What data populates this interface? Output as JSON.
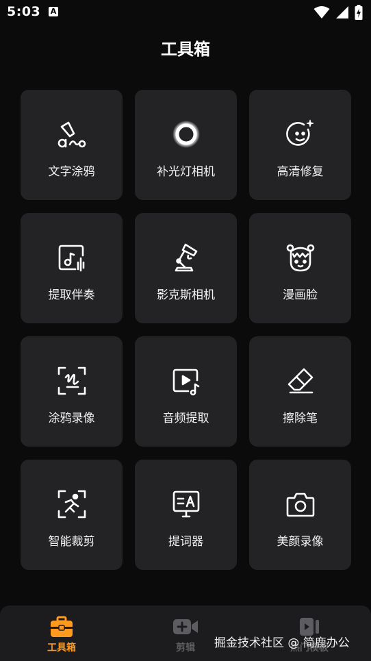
{
  "status_bar": {
    "time": "5:03",
    "notification_letter": "A",
    "icons": [
      "wifi-icon",
      "signal-icon",
      "battery-icon"
    ]
  },
  "page": {
    "title": "工具箱"
  },
  "tools": [
    {
      "label": "文字涂鸦",
      "icon": "text-doodle-icon"
    },
    {
      "label": "补光灯相机",
      "icon": "fill-light-icon"
    },
    {
      "label": "高清修复",
      "icon": "hd-repair-icon"
    },
    {
      "label": "提取伴奏",
      "icon": "extract-accompaniment-icon"
    },
    {
      "label": "影克斯相机",
      "icon": "desk-lamp-camera-icon"
    },
    {
      "label": "漫画脸",
      "icon": "comic-face-icon"
    },
    {
      "label": "涂鸦录像",
      "icon": "doodle-record-icon"
    },
    {
      "label": "音频提取",
      "icon": "audio-extract-icon"
    },
    {
      "label": "擦除笔",
      "icon": "eraser-icon"
    },
    {
      "label": "智能裁剪",
      "icon": "smart-crop-icon"
    },
    {
      "label": "提词器",
      "icon": "teleprompter-icon"
    },
    {
      "label": "美颜录像",
      "icon": "beauty-camera-icon"
    }
  ],
  "bottom_nav": {
    "items": [
      {
        "label": "工具箱",
        "icon": "toolbox-icon",
        "active": true
      },
      {
        "label": "剪辑",
        "icon": "video-add-icon",
        "active": false
      },
      {
        "label": "热门模板",
        "icon": "template-icon",
        "active": false
      }
    ]
  },
  "watermark": "掘金技术社区 @ 简鹿办公",
  "colors": {
    "background": "#0b0b0b",
    "tile": "#232325",
    "accent": "#ff9a1f",
    "nav_inactive": "#5d5d61"
  }
}
